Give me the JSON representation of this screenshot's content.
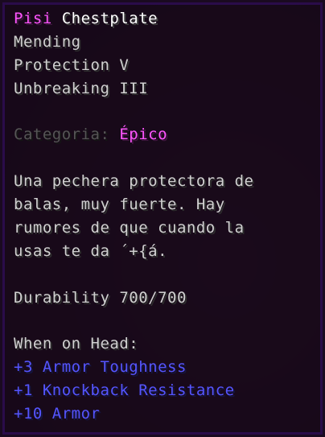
{
  "item": {
    "name_part1": "Pisi",
    "name_part2": "Chestplate"
  },
  "enchantments": [
    "Mending",
    "Protection V",
    "Unbreaking III"
  ],
  "category": {
    "label": "Categoria:",
    "value": "Épico"
  },
  "lore": [
    "Una pechera protectora de",
    "balas, muy fuerte. Hay",
    "rumores de que cuando la",
    "usas te da ´+{á."
  ],
  "durability": "Durability 700/700",
  "equip_header": "When on Head:",
  "attributes": [
    "+3 Armor Toughness",
    "+1 Knockback Resistance",
    "+10 Armor"
  ],
  "colors": {
    "tooltip_bg": "#160618",
    "tooltip_border": "#2a0c4a",
    "name": "#ff55ff",
    "rarity": "#ff55ff",
    "lore": "#d0d0d0",
    "category_label": "#555555",
    "attribute": "#5555ff"
  }
}
